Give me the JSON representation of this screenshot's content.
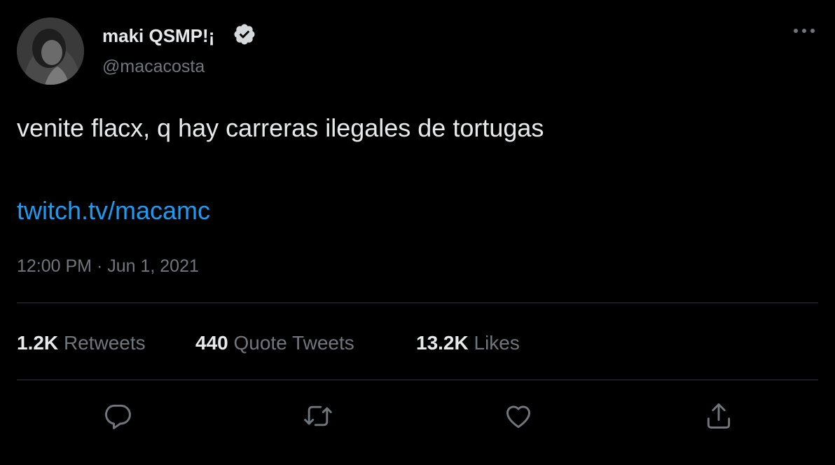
{
  "author": {
    "display_name": "maki QSMP!¡",
    "handle": "@macacosta",
    "verified": true,
    "avatar_icon": "profile-photo"
  },
  "tweet": {
    "text": "venite flacx, q hay carreras ilegales de tortugas",
    "link": "twitch.tv/macamc",
    "timestamp": "12:00 PM · Jun 1, 2021"
  },
  "stats": {
    "retweets_count": "1.2K",
    "retweets_label": "Retweets",
    "quotes_count": "440",
    "quotes_label": "Quote Tweets",
    "likes_count": "13.2K",
    "likes_label": "Likes"
  },
  "actions": [
    "reply-icon",
    "retweet-icon",
    "like-icon",
    "share-icon"
  ],
  "colors": {
    "background": "#000000",
    "text": "#e7e9ea",
    "secondary_text": "#71767b",
    "link": "#1d9bf0",
    "divider": "#2f3336"
  }
}
